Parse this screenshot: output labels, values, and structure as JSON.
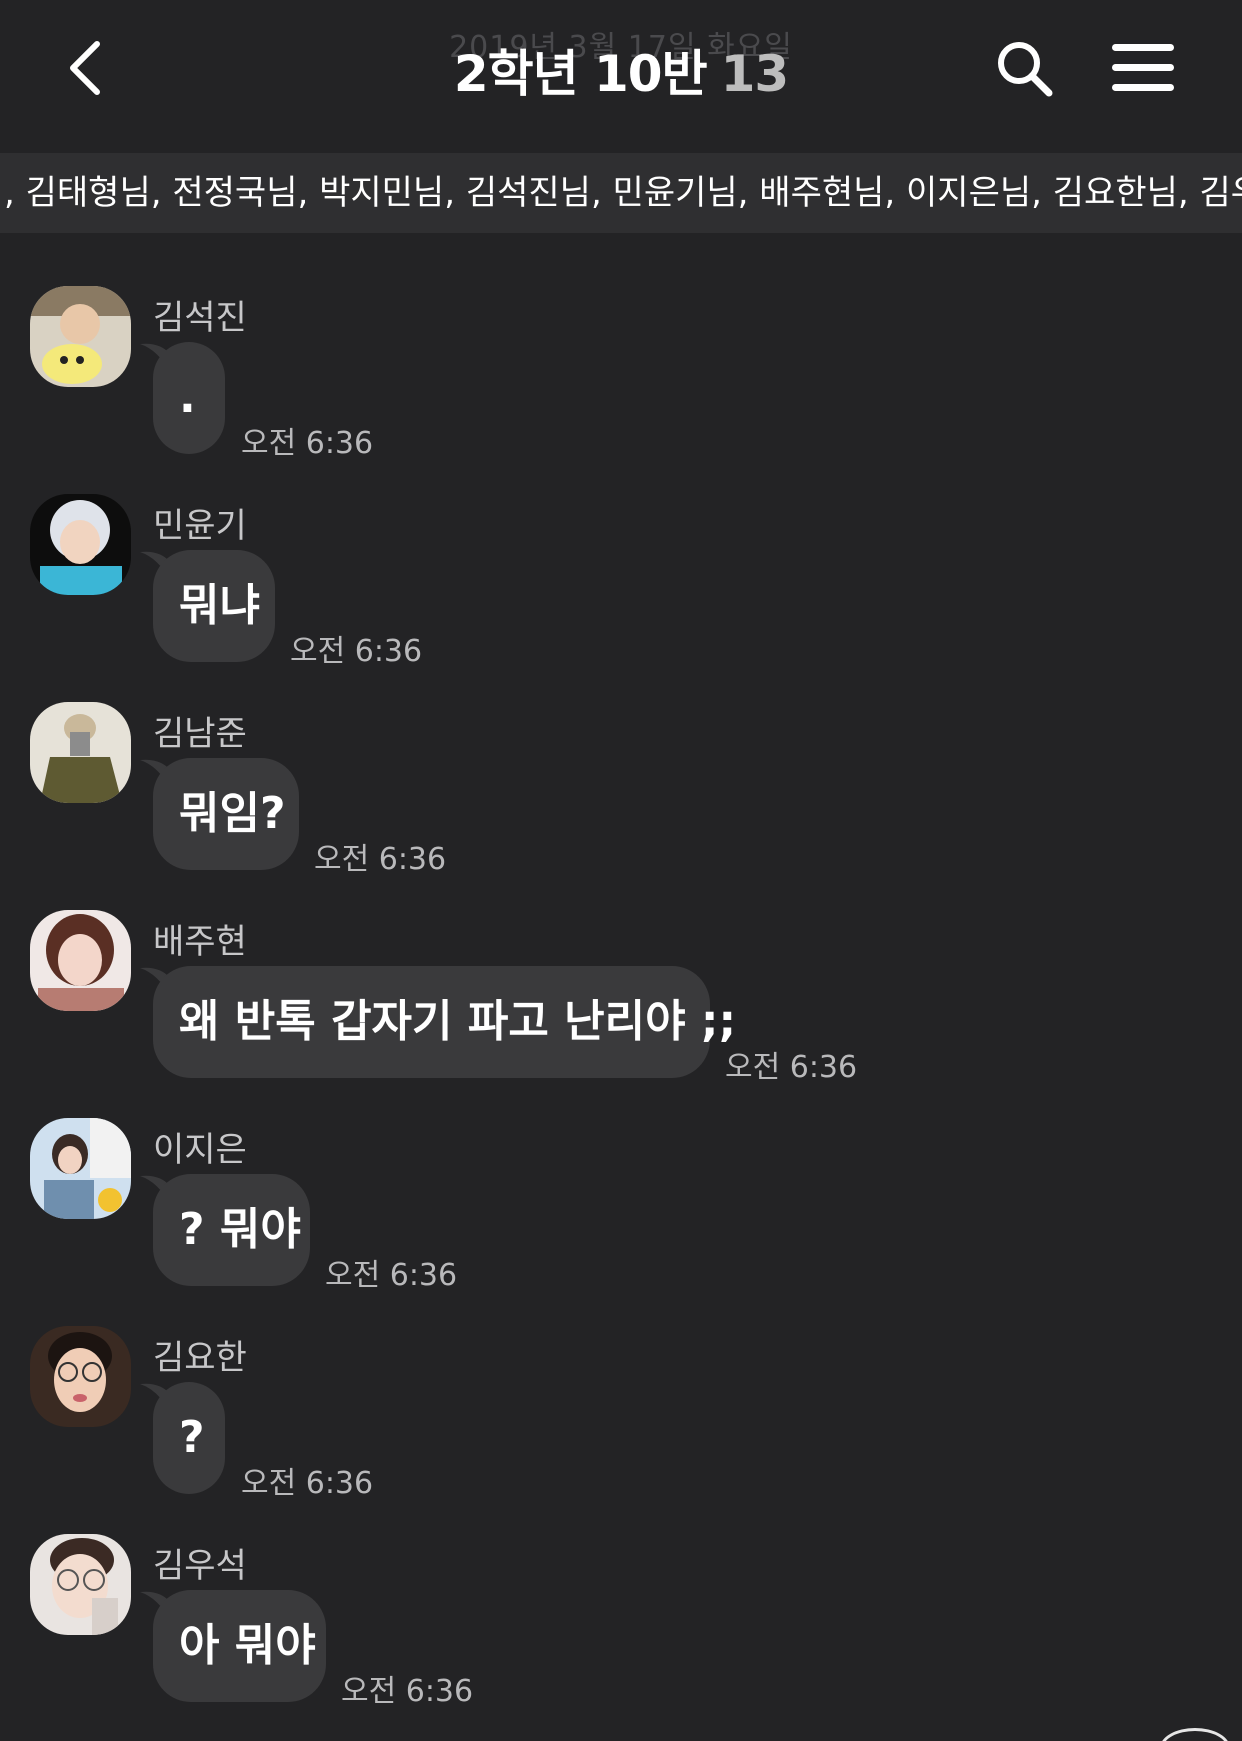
{
  "header": {
    "date_ghost": "2019년 3월 17일 화요일",
    "title": "2학년 10반",
    "member_count": "13"
  },
  "members_strip": ", 김태형님, 전정국님, 박지민님, 김석진님, 민윤기님, 배주현님, 이지은님, 김요한님, 김우",
  "messages": [
    {
      "sender": "김석진",
      "text": ".",
      "time": "오전 6:36",
      "avatar_color": "#b9a48a"
    },
    {
      "sender": "민윤기",
      "text": "뭐냐",
      "time": "오전 6:36",
      "avatar_color": "#d9dde6"
    },
    {
      "sender": "김남준",
      "text": "뭐임?",
      "time": "오전 6:36",
      "avatar_color": "#5e5a32"
    },
    {
      "sender": "배주현",
      "text": "왜 반톡 갑자기 파고 난리야 ;;",
      "time": "오전 6:36",
      "avatar_color": "#b77c72"
    },
    {
      "sender": "이지은",
      "text": "? 뭐야",
      "time": "오전 6:36",
      "avatar_color": "#6f8fae"
    },
    {
      "sender": "김요한",
      "text": "?",
      "time": "오전 6:36",
      "avatar_color": "#5a4a40"
    },
    {
      "sender": "김우석",
      "text": "아 뭐야",
      "time": "오전 6:36",
      "avatar_color": "#d7cfca"
    }
  ],
  "colors": {
    "background": "#232325",
    "bubble": "#3a3a3c",
    "members_strip": "#2f2f31"
  }
}
